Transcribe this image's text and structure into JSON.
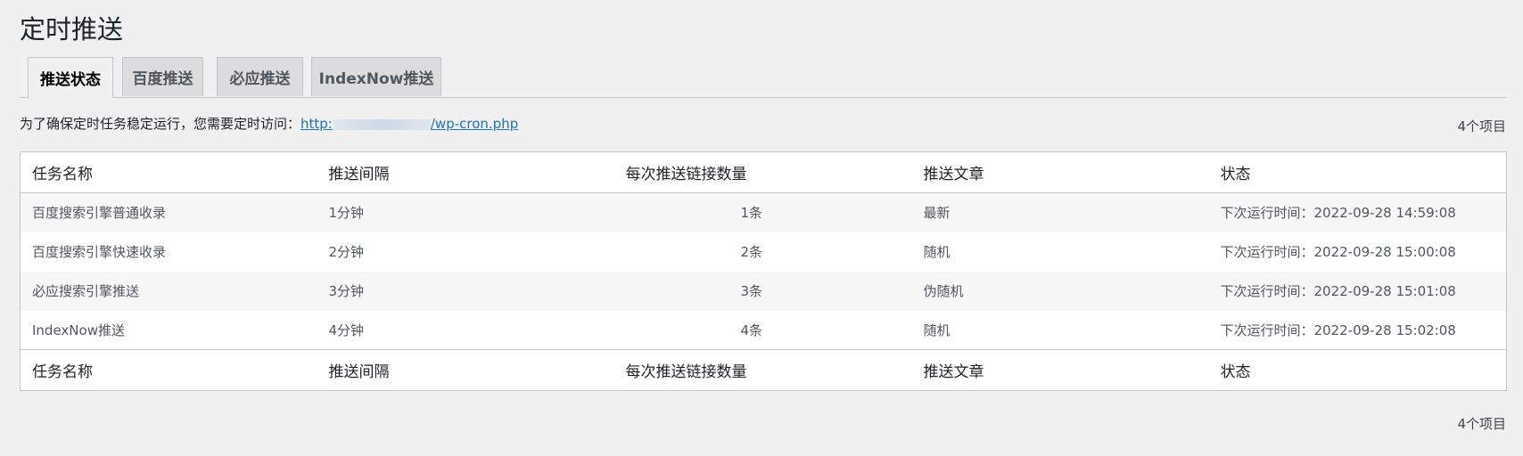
{
  "page": {
    "title": "定时推送"
  },
  "tabs": [
    {
      "label": "推送状态",
      "active": true
    },
    {
      "label": "百度推送",
      "active": false
    },
    {
      "label": "必应推送",
      "active": false
    },
    {
      "label": "IndexNow推送",
      "active": false
    }
  ],
  "notice": {
    "text": "为了确保定时任务稳定运行，您需要定时访问：",
    "link_prefix": "http:",
    "link_suffix": "/wp-cron.php"
  },
  "item_count": "4个项目",
  "table": {
    "columns": [
      "任务名称",
      "推送间隔",
      "每次推送链接数量",
      "推送文章",
      "状态"
    ],
    "rows": [
      [
        "百度搜索引擎普通收录",
        "1分钟",
        "1条",
        "最新",
        "下次运行时间：2022-09-28 14:59:08"
      ],
      [
        "百度搜索引擎快速收录",
        "2分钟",
        "2条",
        "随机",
        "下次运行时间：2022-09-28 15:00:08"
      ],
      [
        "必应搜索引擎推送",
        "3分钟",
        "3条",
        "伪随机",
        "下次运行时间：2022-09-28 15:01:08"
      ],
      [
        "IndexNow推送",
        "4分钟",
        "4条",
        "随机",
        "下次运行时间：2022-09-28 15:02:08"
      ]
    ]
  }
}
